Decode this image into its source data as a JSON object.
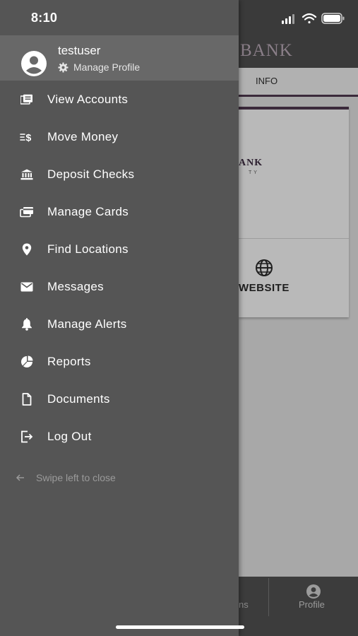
{
  "status_bar": {
    "time": "8:10"
  },
  "background": {
    "brand": "BANK",
    "tab_active": "INFO",
    "card_logo_text": "ANK",
    "card_logo_sub": "TY",
    "website_label": "WEBSITE",
    "bottom_partial_tab": "ns",
    "bottom_profile_label": "Profile"
  },
  "drawer": {
    "username": "testuser",
    "manage_profile": "Manage Profile",
    "items": [
      {
        "label": "View Accounts",
        "icon": "accounts-icon"
      },
      {
        "label": "Move Money",
        "icon": "transfer-money-icon"
      },
      {
        "label": "Deposit Checks",
        "icon": "bank-building-icon"
      },
      {
        "label": "Manage Cards",
        "icon": "cards-icon"
      },
      {
        "label": "Find Locations",
        "icon": "location-pin-icon"
      },
      {
        "label": "Messages",
        "icon": "envelope-icon"
      },
      {
        "label": "Manage Alerts",
        "icon": "bell-icon"
      },
      {
        "label": "Reports",
        "icon": "pie-chart-icon"
      },
      {
        "label": "Documents",
        "icon": "document-icon"
      },
      {
        "label": "Log Out",
        "icon": "logout-icon"
      }
    ],
    "swipe_hint": "Swipe left to close"
  },
  "colors": {
    "drawer_bg": "#555555",
    "drawer_header_bg": "#686868",
    "brand_accent": "#3b2a3b"
  }
}
